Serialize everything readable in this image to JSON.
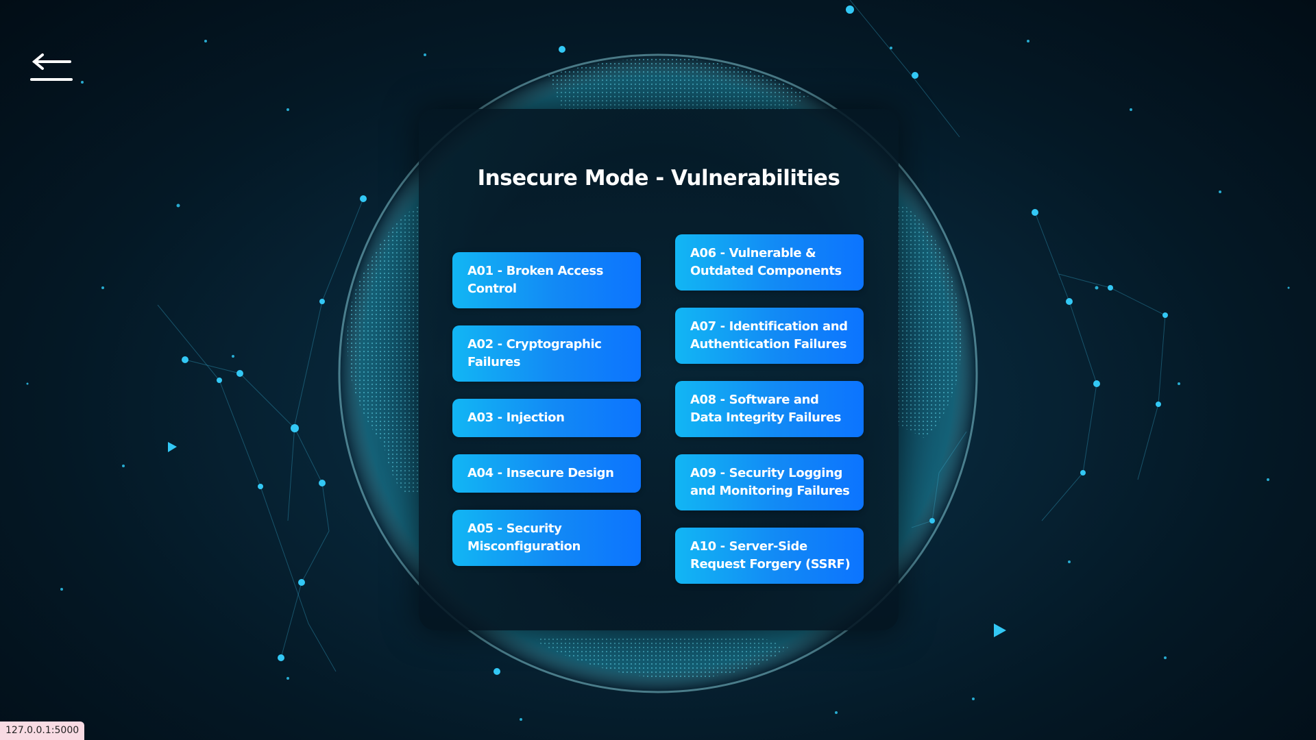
{
  "page": {
    "title": "Insecure Mode - Vulnerabilities"
  },
  "back_button": {
    "icon": "arrow-left-icon"
  },
  "vulnerabilities": {
    "left": [
      {
        "label": "A01 - Broken Access Control"
      },
      {
        "label": "A02 - Cryptographic Failures"
      },
      {
        "label": "A03 - Injection"
      },
      {
        "label": "A04 - Insecure Design"
      },
      {
        "label": "A05 - Security Misconfiguration"
      }
    ],
    "right": [
      {
        "label": "A06 - Vulnerable & Outdated Components"
      },
      {
        "label": "A07 - Identification and Authentication Failures"
      },
      {
        "label": "A08 - Software and Data Integrity Failures"
      },
      {
        "label": "A09 - Security Logging and Monitoring Failures"
      },
      {
        "label": "A10 - Server-Side Request Forgery (SSRF)"
      }
    ]
  },
  "status_bar": {
    "url": "127.0.0.1:5000"
  },
  "colors": {
    "background": "#041825",
    "card": "#061c2a",
    "button_start": "#12b6f4",
    "button_end": "#0c74ff",
    "text": "#ffffff"
  }
}
